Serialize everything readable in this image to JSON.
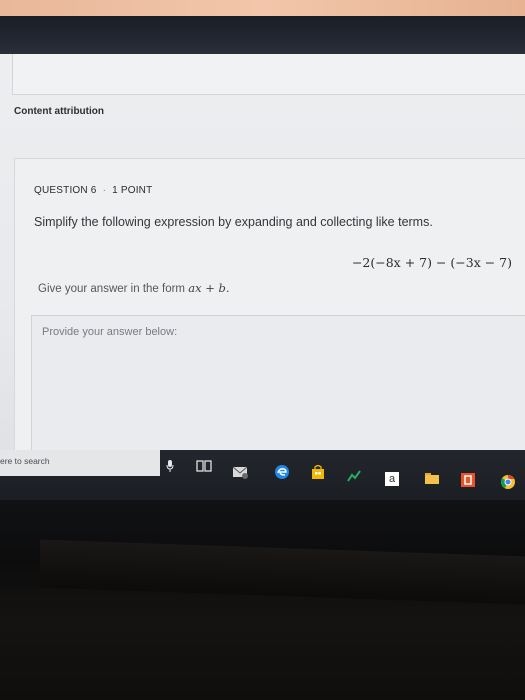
{
  "page": {
    "attribution": "Content attribution"
  },
  "question": {
    "label": "QUESTION 6",
    "separator": "·",
    "points": "1 POINT",
    "prompt": "Simplify the following expression by expanding and collecting like terms.",
    "expression": "−2(−8x + 7) − (−3x − 7)",
    "hint_prefix": "Give your answer in the form",
    "hint_form": "ax + b.",
    "answer_prompt": "Provide your answer below:"
  },
  "taskbar": {
    "search_placeholder": "ere to search",
    "app_a_label": "a"
  },
  "colors": {
    "taskbar": "#1f2328",
    "screen": "#eceef0",
    "edge_blue": "#1e88e5",
    "store_yellow": "#f2b705",
    "office_orange": "#e8542a",
    "chrome_yellow": "#f6c12d"
  },
  "icons": [
    "microphone-icon",
    "task-view-icon",
    "mail-icon",
    "edge-icon",
    "store-icon",
    "stocks-icon",
    "app-a-icon",
    "file-explorer-icon",
    "office-icon",
    "chrome-icon"
  ]
}
